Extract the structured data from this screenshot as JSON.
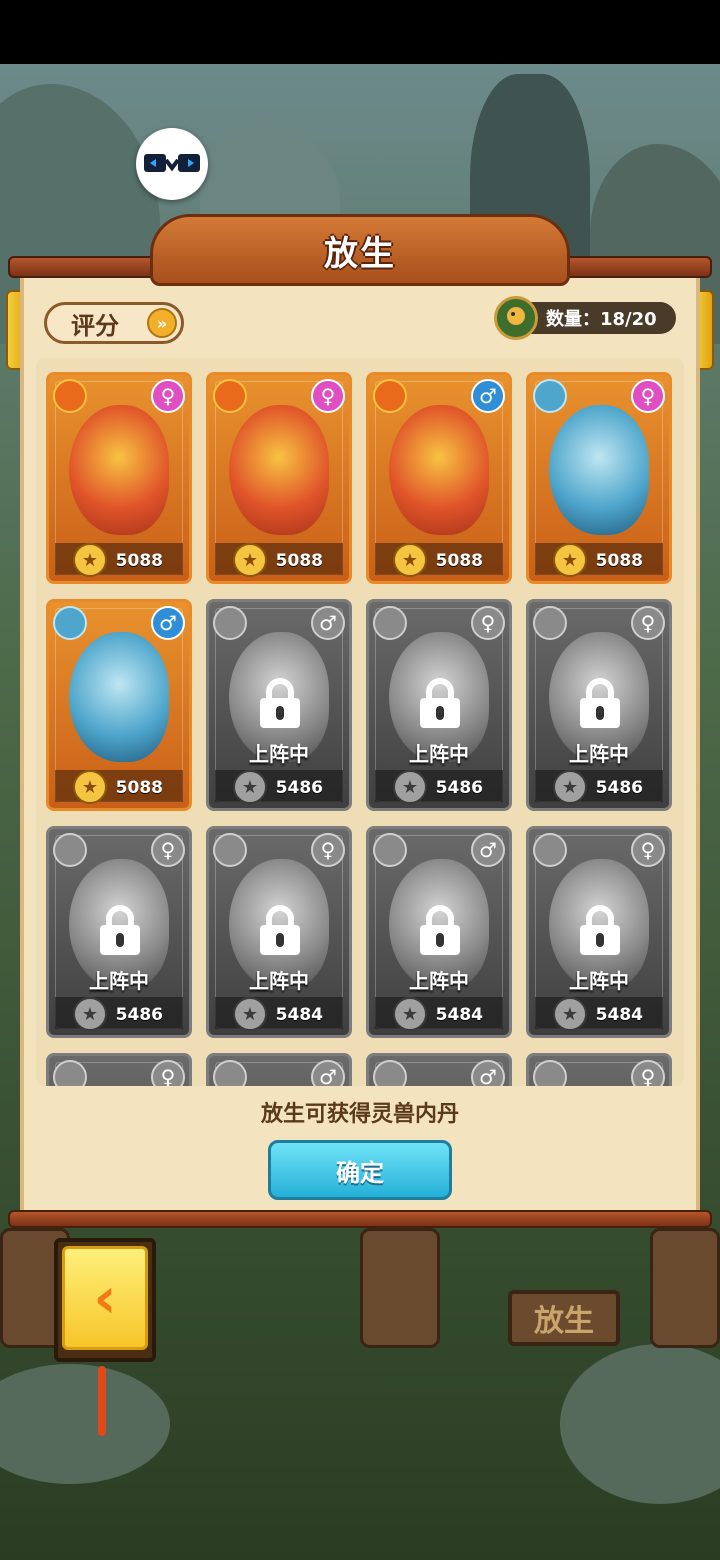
{
  "panel": {
    "title": "放生",
    "sort_label": "评分",
    "sort_arrow": "»",
    "count_text": "数量：18/20"
  },
  "cards": [
    {
      "creature": "phoenix",
      "avatar": "orange",
      "gender": "♀",
      "gender_class": "f",
      "score": "5088",
      "locked": false,
      "tint": "orange"
    },
    {
      "creature": "phoenix",
      "avatar": "orange",
      "gender": "♀",
      "gender_class": "f",
      "score": "5088",
      "locked": false,
      "tint": "orange"
    },
    {
      "creature": "phoenix",
      "avatar": "orange",
      "gender": "♂",
      "gender_class": "m",
      "score": "5088",
      "locked": false,
      "tint": "orange"
    },
    {
      "creature": "dragon",
      "avatar": "blue",
      "gender": "♀",
      "gender_class": "f",
      "score": "5088",
      "locked": false,
      "tint": "orange"
    },
    {
      "creature": "dragon",
      "avatar": "blue",
      "gender": "♂",
      "gender_class": "m",
      "score": "5088",
      "locked": false,
      "tint": "orange"
    },
    {
      "creature": "ghost",
      "avatar": "gray",
      "gender": "♂",
      "gender_class": "g",
      "score": "5486",
      "locked": true,
      "tint": "gray"
    },
    {
      "creature": "ghost",
      "avatar": "gray",
      "gender": "♀",
      "gender_class": "g",
      "score": "5486",
      "locked": true,
      "tint": "gray"
    },
    {
      "creature": "ghost",
      "avatar": "gray",
      "gender": "♀",
      "gender_class": "g",
      "score": "5486",
      "locked": true,
      "tint": "gray"
    },
    {
      "creature": "ghost",
      "avatar": "gray",
      "gender": "♀",
      "gender_class": "g",
      "score": "5486",
      "locked": true,
      "tint": "gray"
    },
    {
      "creature": "ghost",
      "avatar": "gray",
      "gender": "♀",
      "gender_class": "g",
      "score": "5484",
      "locked": true,
      "tint": "gray"
    },
    {
      "creature": "ghost",
      "avatar": "gray",
      "gender": "♂",
      "gender_class": "g",
      "score": "5484",
      "locked": true,
      "tint": "gray"
    },
    {
      "creature": "ghost",
      "avatar": "gray",
      "gender": "♀",
      "gender_class": "g",
      "score": "5484",
      "locked": true,
      "tint": "gray"
    },
    {
      "creature": "ghost",
      "avatar": "gray",
      "gender": "♀",
      "gender_class": "g",
      "score": "",
      "locked": false,
      "tint": "gray"
    },
    {
      "creature": "ghost",
      "avatar": "gray",
      "gender": "♂",
      "gender_class": "g",
      "score": "",
      "locked": false,
      "tint": "gray"
    },
    {
      "creature": "ghost",
      "avatar": "gray",
      "gender": "♂",
      "gender_class": "g",
      "score": "",
      "locked": false,
      "tint": "gray"
    },
    {
      "creature": "ghost",
      "avatar": "gray",
      "gender": "♀",
      "gender_class": "g",
      "score": "",
      "locked": false,
      "tint": "gray"
    }
  ],
  "locked_label": "上阵中",
  "hint_text": "放生可获得灵兽内丹",
  "confirm_label": "确定",
  "back_label": "‹",
  "scene_sign": "放生"
}
